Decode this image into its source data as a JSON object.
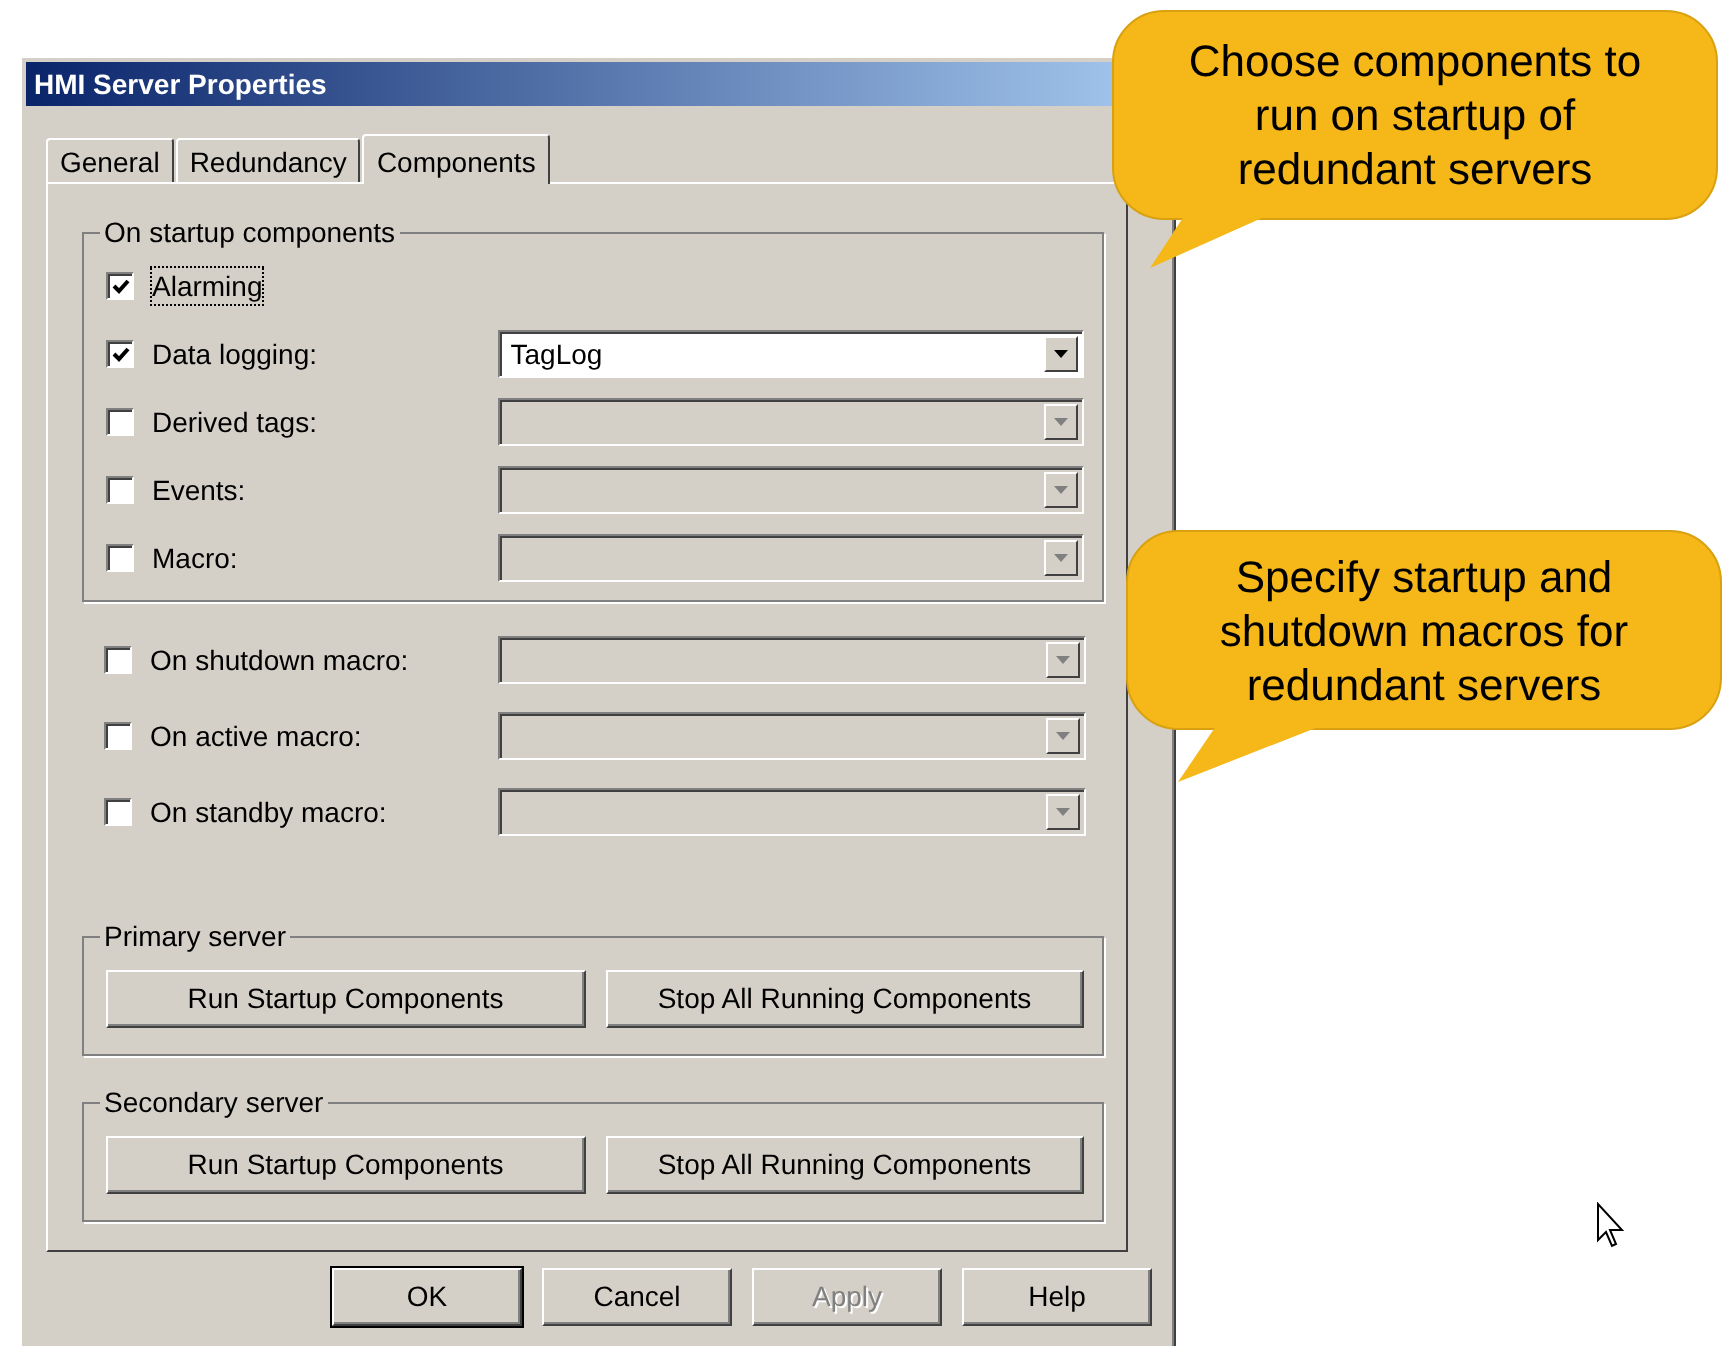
{
  "window": {
    "title": "HMI Server Properties"
  },
  "tabs": [
    {
      "label": "General",
      "selected": false
    },
    {
      "label": "Redundancy",
      "selected": false
    },
    {
      "label": "Components",
      "selected": true
    }
  ],
  "startup_group": {
    "label": "On startup components",
    "items": [
      {
        "label": "Alarming",
        "checked": true,
        "focused": true
      },
      {
        "label": "Data logging:",
        "checked": true,
        "focused": false,
        "dropdown": {
          "value": "TagLog",
          "disabled": false
        }
      },
      {
        "label": "Derived tags:",
        "checked": false,
        "focused": false,
        "dropdown": {
          "disabled": true
        }
      },
      {
        "label": "Events:",
        "checked": false,
        "focused": false,
        "dropdown": {
          "disabled": true
        }
      },
      {
        "label": "Macro:",
        "checked": false,
        "focused": false,
        "dropdown": {
          "disabled": true
        }
      }
    ]
  },
  "macros": [
    {
      "label": "On shutdown macro:",
      "checked": false,
      "dropdown": {
        "disabled": true
      }
    },
    {
      "label": "On active macro:",
      "checked": false,
      "dropdown": {
        "disabled": true
      }
    },
    {
      "label": "On standby macro:",
      "checked": false,
      "dropdown": {
        "disabled": true
      }
    }
  ],
  "server_groups": [
    {
      "label": "Primary server",
      "buttons": [
        "Run Startup Components",
        "Stop All Running Components"
      ]
    },
    {
      "label": "Secondary server",
      "buttons": [
        "Run Startup Components",
        "Stop All Running Components"
      ]
    }
  ],
  "footer_buttons": [
    {
      "label": "OK",
      "default": true,
      "disabled": false
    },
    {
      "label": "Cancel",
      "default": false,
      "disabled": false
    },
    {
      "label": "Apply",
      "default": false,
      "disabled": true
    },
    {
      "label": "Help",
      "default": false,
      "disabled": false
    }
  ],
  "callouts": [
    {
      "text": "Choose components to run on startup of redundant servers"
    },
    {
      "text": "Specify startup and shutdown macros for redundant servers"
    }
  ]
}
